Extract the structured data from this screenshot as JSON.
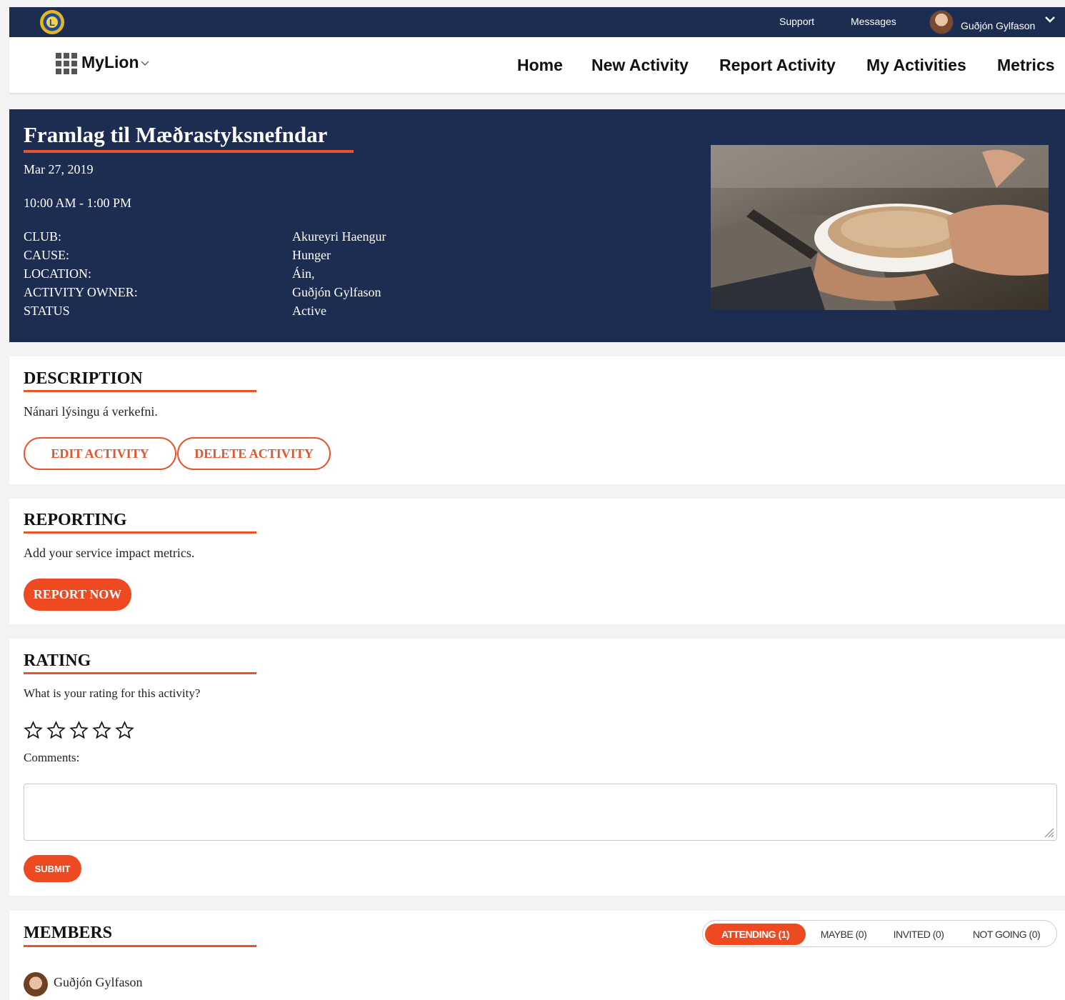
{
  "topbar": {
    "support": "Support",
    "messages": "Messages",
    "user_name": "Guðjón Gylfason"
  },
  "nav": {
    "app_name": "MyLion",
    "links": [
      "Home",
      "New Activity",
      "Report Activity",
      "My Activities",
      "Metrics"
    ]
  },
  "activity": {
    "title": "Framlag til Mæðrastyksnefndar",
    "date": "Mar 27, 2019",
    "time": "10:00 AM - 1:00 PM",
    "details": [
      {
        "label": "CLUB:",
        "value": "Akureyri Haengur"
      },
      {
        "label": "CAUSE:",
        "value": "Hunger"
      },
      {
        "label": "LOCATION:",
        "value": "Áin,"
      },
      {
        "label": "ACTIVITY OWNER:",
        "value": "Guðjón Gylfason"
      },
      {
        "label": "STATUS",
        "value": "Active"
      }
    ]
  },
  "description": {
    "title": "DESCRIPTION",
    "text": "Nánari lýsingu á verkefni.",
    "edit_label": "EDIT ACTIVITY",
    "delete_label": "DELETE ACTIVITY"
  },
  "reporting": {
    "title": "REPORTING",
    "text": "Add your service impact metrics.",
    "report_label": "REPORT NOW"
  },
  "rating": {
    "title": "RATING",
    "question": "What is your rating for this activity?",
    "value": 0,
    "max": 5,
    "comments_label": "Comments:",
    "comments_value": "",
    "submit_label": "SUBMIT"
  },
  "members": {
    "title": "MEMBERS",
    "tabs": [
      {
        "label": "ATTENDING (1)",
        "active": true
      },
      {
        "label": "MAYBE (0)",
        "active": false
      },
      {
        "label": "INVITED (0)",
        "active": false
      },
      {
        "label": "NOT GOING (0)",
        "active": false
      }
    ],
    "list": [
      {
        "name": "Guðjón Gylfason"
      }
    ]
  },
  "colors": {
    "navy": "#1c2d51",
    "accent": "#e8532a",
    "button": "#ee4a22"
  }
}
